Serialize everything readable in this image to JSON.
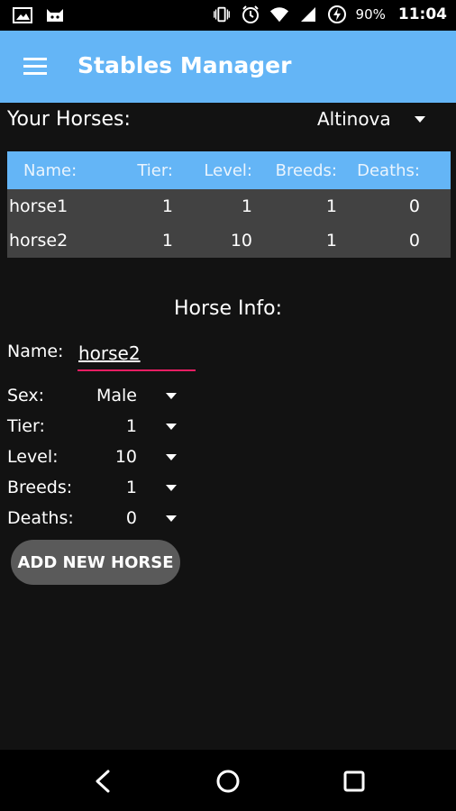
{
  "status_bar": {
    "battery_percent": "90%",
    "time": "11:04",
    "icons": [
      "image-icon",
      "cat-icon",
      "vibrate-icon",
      "alarm-icon",
      "wifi-icon",
      "signal-icon",
      "battery-saver-icon"
    ]
  },
  "app_bar": {
    "title": "Stables Manager",
    "menu_icon": "hamburger-menu-icon"
  },
  "horses_header": {
    "label": "Your Horses:",
    "realm_selected": "Altinova"
  },
  "table": {
    "columns": [
      "Name:",
      "Tier:",
      "Level:",
      "Breeds:",
      "Deaths:"
    ],
    "rows": [
      [
        "horse1",
        "1",
        "1",
        "1",
        "0"
      ],
      [
        "horse2",
        "1",
        "10",
        "1",
        "0"
      ]
    ]
  },
  "horse_info": {
    "title": "Horse Info:",
    "name_label": "Name:",
    "name_value": "horse2",
    "fields": [
      {
        "label": "Sex:",
        "value": "Male"
      },
      {
        "label": "Tier:",
        "value": "1"
      },
      {
        "label": "Level:",
        "value": "10"
      },
      {
        "label": "Breeds:",
        "value": "1"
      },
      {
        "label": "Deaths:",
        "value": "0"
      }
    ],
    "add_button": "ADD NEW HORSE"
  },
  "nav_bar": {
    "icons": [
      "back-icon",
      "home-icon",
      "recents-icon"
    ]
  },
  "colors": {
    "accent": "#64b5f6",
    "underline": "#e91e63",
    "background": "#121212",
    "row": "#424242"
  }
}
